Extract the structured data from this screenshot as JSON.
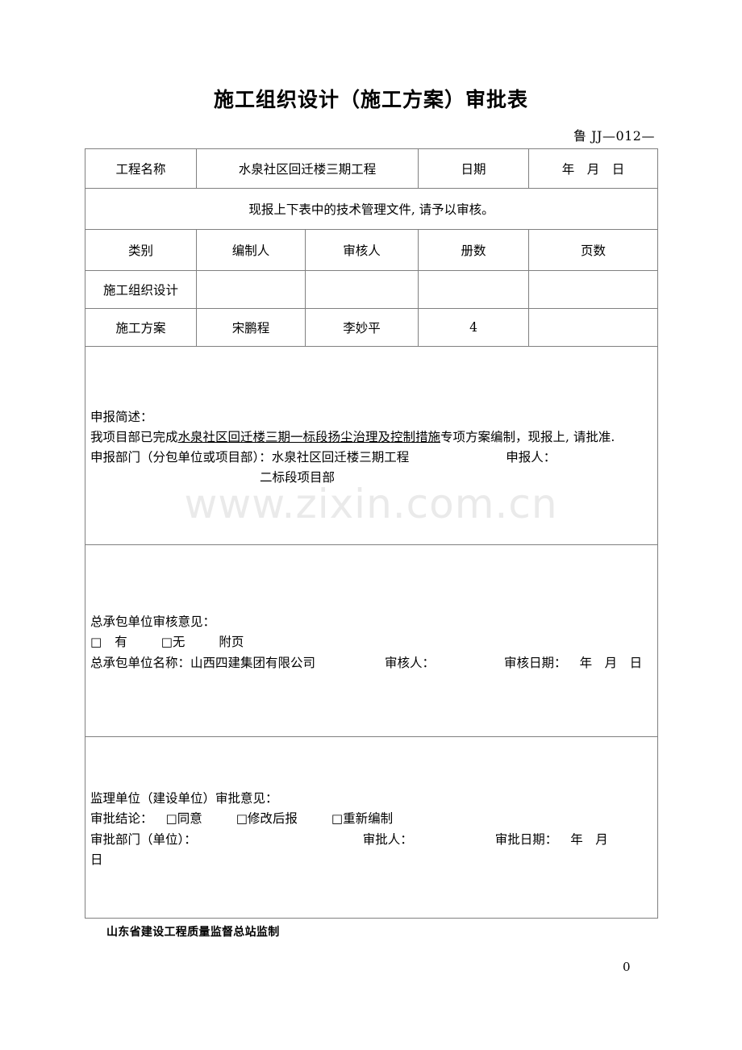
{
  "document": {
    "title": "施工组织设计（施工方案）审批表",
    "form_code": "鲁 JJ—012—",
    "footer_note": "山东省建设工程质量监督总站监制",
    "page_number": "0",
    "watermark": "www.zixin.com.cn"
  },
  "project_row": {
    "label": "工程名称",
    "value": "水泉社区回迁楼三期工程",
    "date_label": "日期",
    "date_value": "年　月　日"
  },
  "note_row": {
    "text": "现报上下表中的技术管理文件, 请予以审核。"
  },
  "table_headers": {
    "category": "类别",
    "preparer": "编制人",
    "reviewer": "审核人",
    "volumes": "册数",
    "pages": "页数"
  },
  "table_rows": [
    {
      "category": "施工组织设计",
      "preparer": "",
      "reviewer": "",
      "volumes": "",
      "pages": ""
    },
    {
      "category": "施工方案",
      "preparer": "宋鹏程",
      "reviewer": "李妙平",
      "volumes": "4",
      "pages": ""
    }
  ],
  "application": {
    "heading": "申报简述：",
    "line2_prefix": "我项目部已完成",
    "line2_underlined": "水泉社区回迁楼三期一标段扬尘治理及控制措施",
    "line2_suffix": "专项方案编制，现报上, 请批准.",
    "dept_label": "申报部门（分包单位或项目部）：",
    "dept_value": "水泉社区回迁楼三期工程",
    "applicant_label": "申报人：",
    "dept_value_line2": "二标段项目部"
  },
  "contractor": {
    "heading": "总承包单位审核意见：",
    "checkbox_glyph": "□",
    "option_yes": "有",
    "option_no": "无",
    "attachment_label": "附页",
    "name_label": "总承包单位名称：",
    "name_value": "山西四建集团有限公司",
    "reviewer_label": "审核人：",
    "date_label": "审核日期：",
    "date_value": "年　月　日"
  },
  "supervisor": {
    "heading": "监理单位（建设单位）审批意见：",
    "conclusion_label": "审批结论：",
    "checkbox_glyph": "□",
    "option_agree": "同意",
    "option_revise": "修改后报",
    "option_rewrite": "重新编制",
    "dept_label": "审批部门（单位）：",
    "approver_label": "审批人：",
    "date_label": "审批日期：",
    "date_value": "年　月",
    "date_value_line2": "日"
  }
}
